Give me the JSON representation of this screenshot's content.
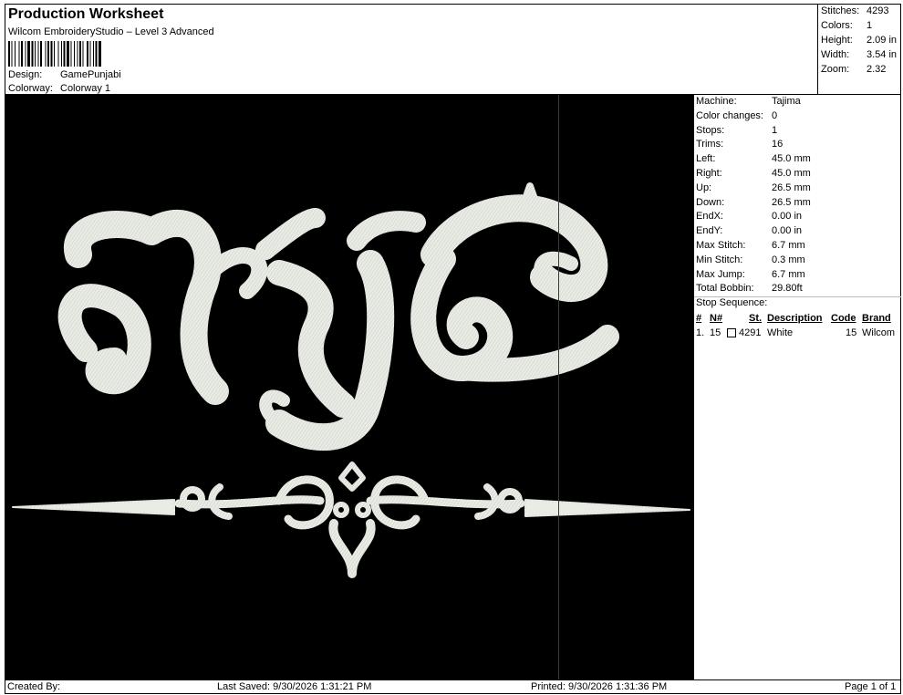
{
  "header": {
    "title": "Production Worksheet",
    "subtitle": "Wilcom EmbroideryStudio – Level 3 Advanced",
    "design_label": "Design:",
    "design_value": "GamePunjabi",
    "colorway_label": "Colorway:",
    "colorway_value": "Colorway 1"
  },
  "summary": [
    {
      "label": "Stitches:",
      "value": "4293"
    },
    {
      "label": "Colors:",
      "value": "1"
    },
    {
      "label": "Height:",
      "value": "2.09 in"
    },
    {
      "label": "Width:",
      "value": "3.54 in"
    },
    {
      "label": "Zoom:",
      "value": "2.32"
    }
  ],
  "properties": [
    {
      "label": "Machine:",
      "value": "Tajima"
    },
    {
      "label": "Color changes:",
      "value": "0"
    },
    {
      "label": "Stops:",
      "value": "1"
    },
    {
      "label": "Trims:",
      "value": "16"
    },
    {
      "label": "Left:",
      "value": "45.0 mm"
    },
    {
      "label": "Right:",
      "value": "45.0 mm"
    },
    {
      "label": "Up:",
      "value": "26.5 mm"
    },
    {
      "label": "Down:",
      "value": "26.5 mm"
    },
    {
      "label": "EndX:",
      "value": "0.00 in"
    },
    {
      "label": "EndY:",
      "value": "0.00 in"
    },
    {
      "label": "Max Stitch:",
      "value": "6.7 mm"
    },
    {
      "label": "Min Stitch:",
      "value": "0.3 mm"
    },
    {
      "label": "Max Jump:",
      "value": "6.7 mm"
    },
    {
      "label": "Total Bobbin:",
      "value": "29.80ft"
    }
  ],
  "stop_sequence": {
    "title": "Stop Sequence:",
    "headers": {
      "num": "#",
      "needle": "N#",
      "stitches": "St.",
      "description": "Description",
      "code": "Code",
      "brand": "Brand"
    },
    "rows": [
      {
        "num": "1.",
        "needle": "15",
        "stitches": "4291",
        "description": "White",
        "code": "15",
        "brand": "Wilcom"
      }
    ]
  },
  "footer": {
    "created_by": "Created By:",
    "last_saved": "Last Saved: 9/30/2026 1:31:21 PM",
    "printed": "Printed: 9/30/2026 1:31:36 PM",
    "page": "Page 1 of 1"
  },
  "colors": {
    "canvas_bg": "#000000",
    "thread": "#e8ebe4",
    "thread_shadow": "#9aa096"
  }
}
